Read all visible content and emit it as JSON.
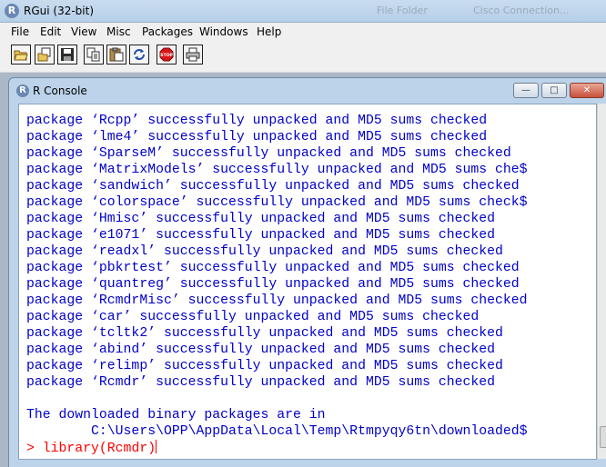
{
  "window": {
    "title": "RGui (32-bit)",
    "background_ghost_text": [
      "File Folder",
      "Cisco Connection..."
    ]
  },
  "menubar": {
    "items": [
      "File",
      "Edit",
      "View",
      "Misc",
      "Packages",
      "Windows",
      "Help"
    ]
  },
  "toolbar": {
    "buttons": [
      {
        "icon": "open-script-icon"
      },
      {
        "icon": "load-workspace-icon"
      },
      {
        "icon": "save-workspace-icon"
      },
      {
        "icon": "copy-icon"
      },
      {
        "icon": "paste-icon"
      },
      {
        "icon": "copy-paste-icon"
      },
      {
        "icon": "stop-icon",
        "label": "STOP"
      },
      {
        "icon": "print-icon"
      }
    ]
  },
  "console": {
    "title": "R Console",
    "lines": [
      "package ‘Rcpp’ successfully unpacked and MD5 sums checked",
      "package ‘lme4’ successfully unpacked and MD5 sums checked",
      "package ‘SparseM’ successfully unpacked and MD5 sums checked",
      "package ‘MatrixModels’ successfully unpacked and MD5 sums che$",
      "package ‘sandwich’ successfully unpacked and MD5 sums checked",
      "package ‘colorspace’ successfully unpacked and MD5 sums check$",
      "package ‘Hmisc’ successfully unpacked and MD5 sums checked",
      "package ‘e1071’ successfully unpacked and MD5 sums checked",
      "package ‘readxl’ successfully unpacked and MD5 sums checked",
      "package ‘pbkrtest’ successfully unpacked and MD5 sums checked",
      "package ‘quantreg’ successfully unpacked and MD5 sums checked",
      "package ‘RcmdrMisc’ successfully unpacked and MD5 sums checked",
      "package ‘car’ successfully unpacked and MD5 sums checked",
      "package ‘tcltk2’ successfully unpacked and MD5 sums checked",
      "package ‘abind’ successfully unpacked and MD5 sums checked",
      "package ‘relimp’ successfully unpacked and MD5 sums checked",
      "package ‘Rcmdr’ successfully unpacked and MD5 sums checked",
      "",
      "The downloaded binary packages are in",
      "        C:\\Users\\OPP\\AppData\\Local\\Temp\\Rtmpyqy6tn\\downloaded$"
    ],
    "prompt": "> ",
    "input": "library(Rcmdr)"
  },
  "colors": {
    "output_text": "#0000cc",
    "input_text": "#ff0000",
    "title_bar": "#bcd3ea",
    "mdi_background": "#abb8c8"
  }
}
